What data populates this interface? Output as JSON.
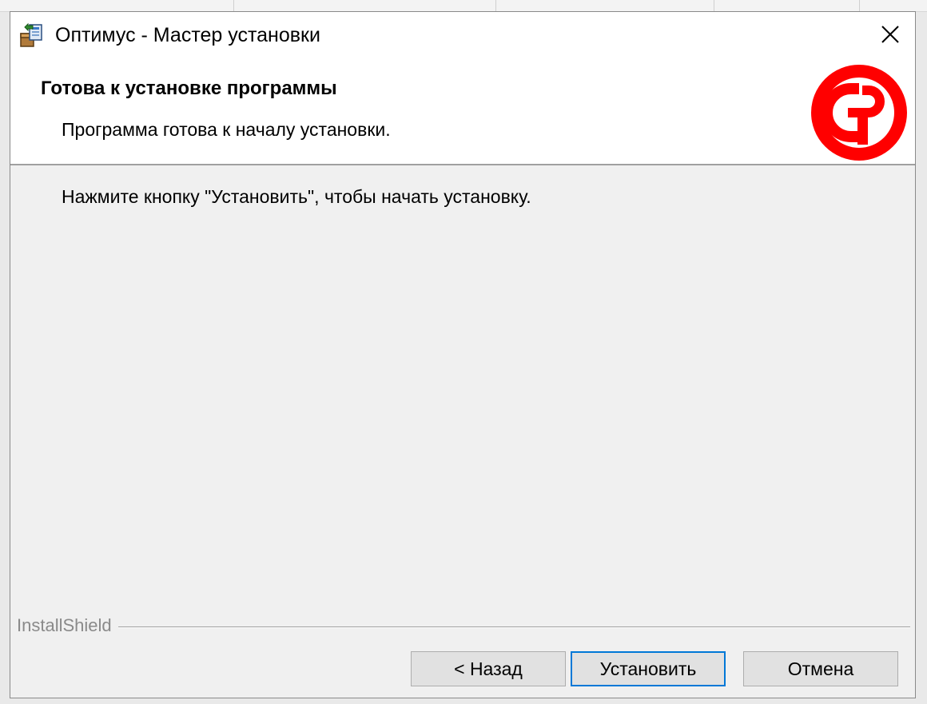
{
  "window": {
    "title": "Оптимус - Мастер установки",
    "app_icon": "installer-package-icon",
    "close_icon": "close-x-icon"
  },
  "header": {
    "title": "Готова к установке программы",
    "subtitle": "Программа готова к началу установки.",
    "logo_icon": "company-logo-icon",
    "logo_color": "#ff0000"
  },
  "body": {
    "text": "Нажмите кнопку \"Установить\", чтобы начать установку."
  },
  "footer": {
    "brand": "InstallShield"
  },
  "buttons": {
    "back": "< Назад",
    "install": "Установить",
    "cancel": "Отмена"
  },
  "colors": {
    "accent": "#0078d7",
    "dialog_bg": "#f0f0f0",
    "header_bg": "#ffffff"
  }
}
